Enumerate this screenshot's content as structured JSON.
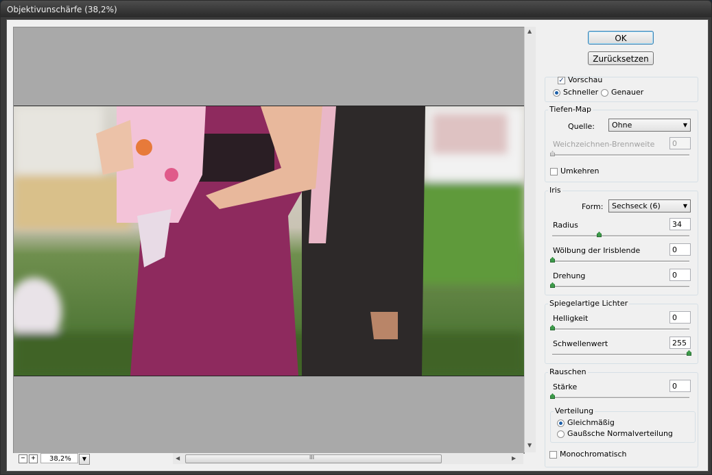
{
  "window": {
    "title": "Objektivunschärfe (38,2%)"
  },
  "preview": {
    "zoom": "38,2%",
    "zoom_minus": "−",
    "zoom_plus": "+",
    "scroll_grip": "III"
  },
  "buttons": {
    "ok": "OK",
    "reset": "Zurücksetzen"
  },
  "preview_options": {
    "checkbox": "Vorschau",
    "checked": true,
    "fast": "Schneller",
    "accurate": "Genauer",
    "selected": "Schneller"
  },
  "depth_map": {
    "title": "Tiefen-Map",
    "source_label": "Quelle:",
    "source_value": "Ohne",
    "blur_focal_label": "Weichzeichnen-Brennweite",
    "blur_focal_value": "0",
    "invert_label": "Umkehren",
    "invert_checked": false
  },
  "iris": {
    "title": "Iris",
    "shape_label": "Form:",
    "shape_value": "Sechseck (6)",
    "radius_label": "Radius",
    "radius_value": "34",
    "radius_level": 0.34,
    "curvature_label": "Wölbung der Irisblende",
    "curvature_value": "0",
    "rotation_label": "Drehung",
    "rotation_value": "0"
  },
  "specular": {
    "title": "Spiegelartige Lichter",
    "brightness_label": "Helligkeit",
    "brightness_value": "0",
    "threshold_label": "Schwellenwert",
    "threshold_value": "255"
  },
  "noise": {
    "title": "Rauschen",
    "amount_label": "Stärke",
    "amount_value": "0",
    "distribution_title": "Verteilung",
    "uniform": "Gleichmäßig",
    "gaussian": "Gaußsche Normalverteilung",
    "selected": "Gleichmäßig",
    "mono_label": "Monochromatisch",
    "mono_checked": false
  },
  "colors": {
    "accent": "#3c9a49",
    "dress": "#8e2a5e",
    "lawn": "#4f8a2e",
    "suit": "#2b2727"
  }
}
